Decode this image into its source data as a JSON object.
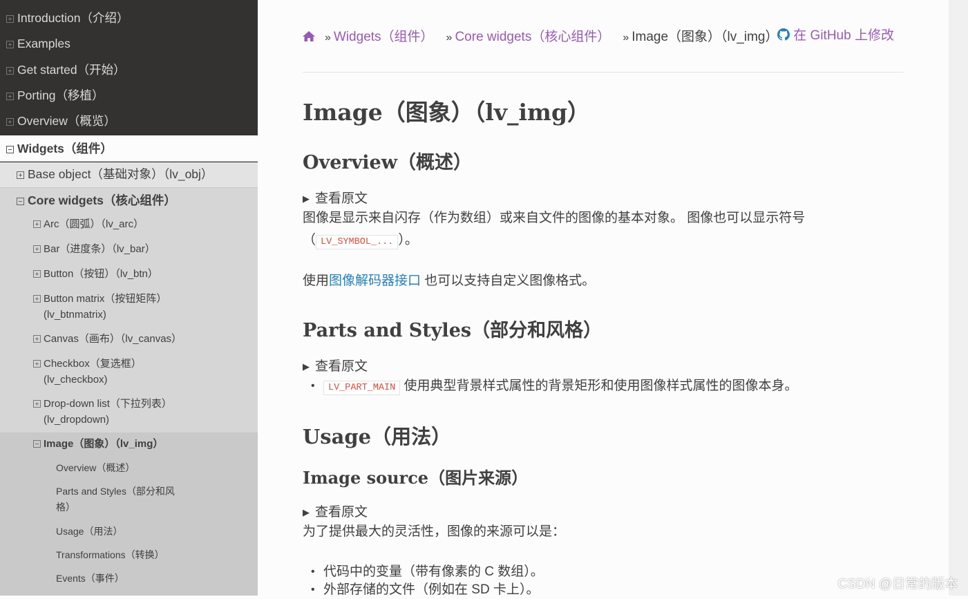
{
  "sidebar": {
    "top_items": [
      "Introduction（介绍）",
      "Examples",
      "Get started（开始）",
      "Porting（移植）",
      "Overview（概览）"
    ],
    "widgets": "Widgets（组件）",
    "base_object": "Base object（基础对象）（lv_obj）",
    "core_widgets": "Core widgets（核心组件）",
    "core_items": [
      {
        "l1": "Arc（圆弧）（lv_arc）"
      },
      {
        "l1": "Bar（进度条）（lv_bar）"
      },
      {
        "l1": "Button（按钮）（lv_btn）"
      },
      {
        "l1": "Button matrix（按钮矩阵）",
        "l2": "(lv_btnmatrix)"
      },
      {
        "l1": "Canvas（画布）（lv_canvas）"
      },
      {
        "l1": "Checkbox（复选框）",
        "l2": "(lv_checkbox)"
      },
      {
        "l1": "Drop-down list（下拉列表）",
        "l2": "(lv_dropdown)"
      }
    ],
    "image_item": "Image（图象）（lv_img）",
    "image_sub": [
      {
        "l1": "Overview（概述）"
      },
      {
        "l1": "Parts and Styles（部分和风",
        "l2": "格）"
      },
      {
        "l1": "Usage（用法）"
      },
      {
        "l1": "Transformations（转换）"
      },
      {
        "l1": "Events（事件）"
      }
    ]
  },
  "breadcrumb": {
    "sep": "»",
    "widgets": "Widgets（组件）",
    "core": "Core widgets（核心组件）",
    "current": "Image（图象）（lv_img）",
    "github": "在 GitHub 上修改"
  },
  "content": {
    "title": "Image（图象）（lv_img）",
    "overview_heading": "Overview（概述）",
    "view_original": "查看原文",
    "overview_text_1": "图像是显示来自闪存（作为数组）或来自文件的图像的基本对象。 图像也可以显示符号",
    "open_paren": "（",
    "symbol_code": "LV_SYMBOL_...",
    "close_paren": "）。",
    "decoder_prefix": "使用",
    "decoder_link": "图像解码器接口",
    "decoder_suffix": " 也可以支持自定义图像格式。",
    "parts_heading": "Parts and Styles（部分和风格）",
    "part_main_code": "LV_PART_MAIN",
    "part_main_text": " 使用典型背景样式属性的背景矩形和使用图像样式属性的图像本身。",
    "usage_heading": "Usage（用法）",
    "source_heading": "Image source（图片来源）",
    "source_intro": "为了提供最大的灵活性，图像的来源可以是：",
    "source_items": [
      "代码中的变量（带有像素的 C 数组）。",
      "外部存储的文件（例如在 SD 卡上）。"
    ]
  },
  "watermark": "CSDN @日常的版本",
  "colors": {
    "sidebar_bg": "#343131",
    "link_purple": "#9b59b6",
    "link_blue": "#2980b9",
    "code_red": "#e74c3c"
  }
}
